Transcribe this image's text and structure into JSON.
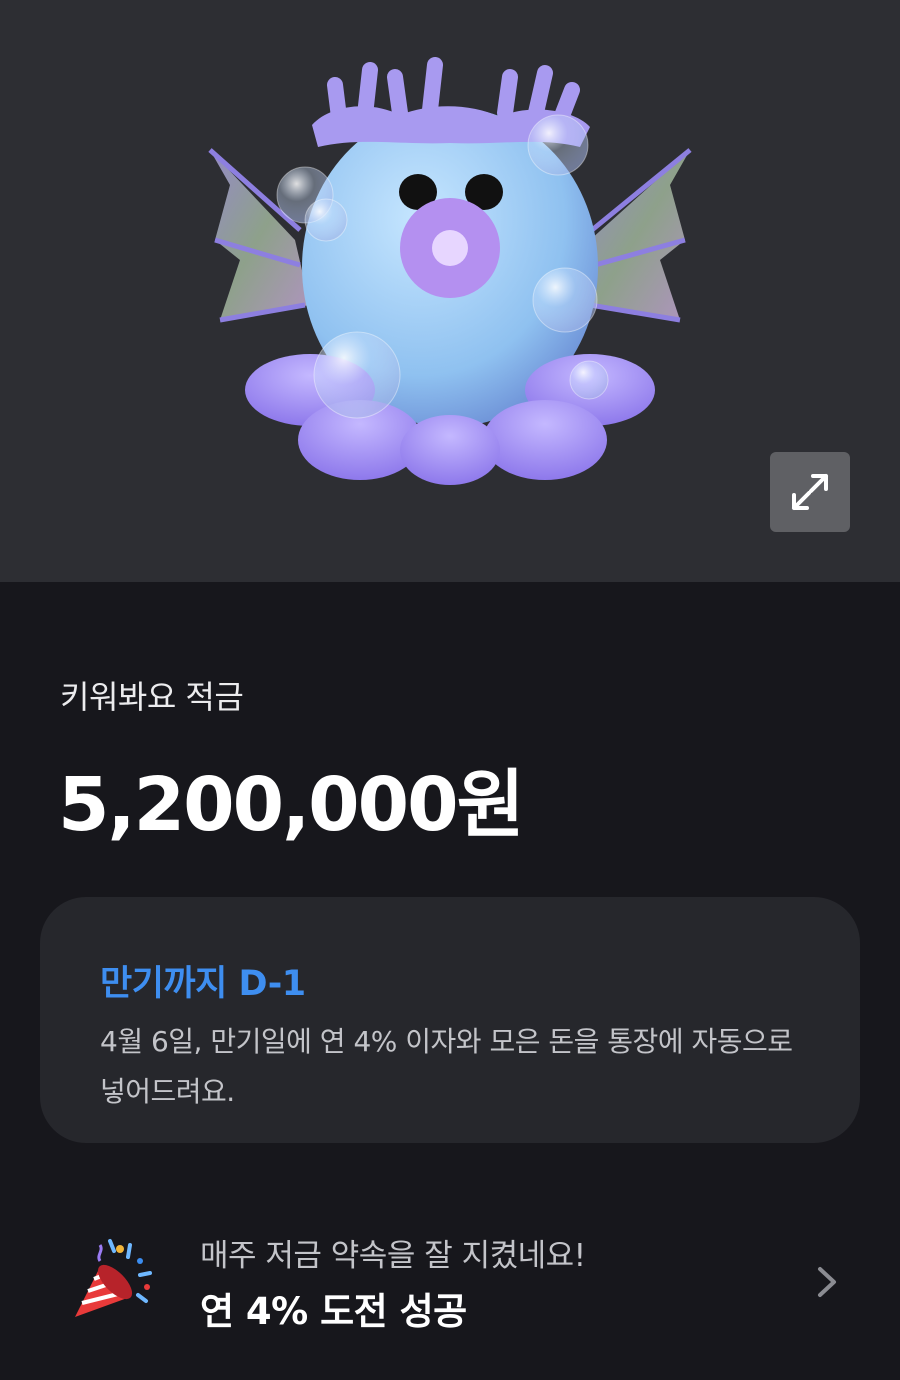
{
  "hero": {
    "character": "purple-octopus-with-bubbles",
    "expand_icon": "expand-arrows-icon",
    "background_color": "#2d2e33"
  },
  "product": {
    "name": "키워봐요 적금",
    "balance": "5,200,000원"
  },
  "maturity_card": {
    "title": "만기까지 D-1",
    "description": "4월 6일, 만기일에 연 4% 이자와 모은 돈을 통장에 자동으로 넣어드려요.",
    "accent_color": "#3e8ef0"
  },
  "challenge": {
    "icon": "party-popper-icon",
    "subtitle": "매주 저금 약속을 잘 지켰네요!",
    "title": "연 4% 도전 성공",
    "chevron": "chevron-right-icon"
  }
}
